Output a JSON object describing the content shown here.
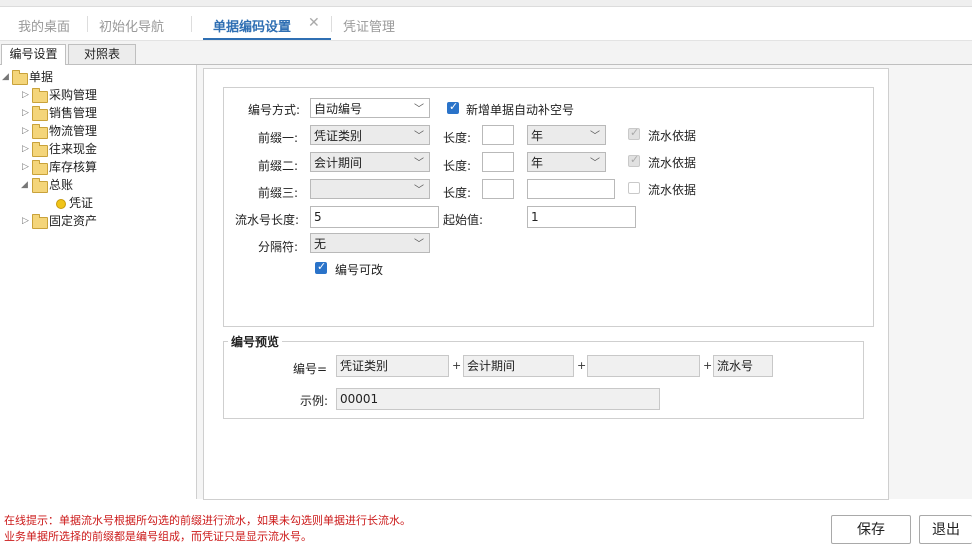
{
  "tabs": [
    {
      "label": "我的桌面"
    },
    {
      "label": "初始化导航"
    },
    {
      "label": "单据编码设置"
    },
    {
      "label": "凭证管理"
    }
  ],
  "subtabs": [
    {
      "label": "编号设置"
    },
    {
      "label": "对照表"
    }
  ],
  "tree": {
    "root": "单据",
    "items": [
      {
        "label": "采购管理"
      },
      {
        "label": "销售管理"
      },
      {
        "label": "物流管理"
      },
      {
        "label": "往来现金"
      },
      {
        "label": "库存核算"
      },
      {
        "label": "总账"
      },
      {
        "label": "凭证"
      },
      {
        "label": "固定资产"
      }
    ]
  },
  "form": {
    "numbering_method_label": "编号方式:",
    "numbering_method_value": "自动编号",
    "auto_fill_label": "新增单据自动补空号",
    "prefix1_label": "前缀一:",
    "prefix1_value": "凭证类别",
    "prefix2_label": "前缀二:",
    "prefix2_value": "会计期间",
    "prefix3_label": "前缀三:",
    "prefix3_value": "",
    "length_label": "长度:",
    "len1_value": "",
    "len2_value": "",
    "len3_value": "",
    "unit1_value": "年",
    "unit2_value": "年",
    "unit3_value": "",
    "serial_basis_label": "流水依据",
    "serial_length_label": "流水号长度:",
    "serial_length_value": "5",
    "start_value_label": "起始值:",
    "start_value_value": "1",
    "separator_label": "分隔符:",
    "separator_value": "无",
    "editable_label": "编号可改"
  },
  "preview": {
    "title": "编号预览",
    "number_label": "编号=",
    "part1": "凭证类别",
    "part2": "会计期间",
    "part3": "",
    "part4": "流水号",
    "plus": "+",
    "example_label": "示例:",
    "example_value": "00001"
  },
  "hint": {
    "line1": "在线提示：单据流水号根据所勾选的前缀进行流水，如果未勾选则单据进行长流水。",
    "line2": "业务单据所选择的前缀都是编号组成，而凭证只是显示流水号。"
  },
  "buttons": {
    "save": "保存",
    "exit": "退出"
  },
  "colors": {
    "accent": "#2f6fb3",
    "hint_text": "#cc1a1a",
    "checkbox": "#2a73c9"
  },
  "checks": {
    "auto_fill": true,
    "serial_basis_1": true,
    "serial_basis_2": true,
    "serial_basis_3": false,
    "editable": true
  }
}
